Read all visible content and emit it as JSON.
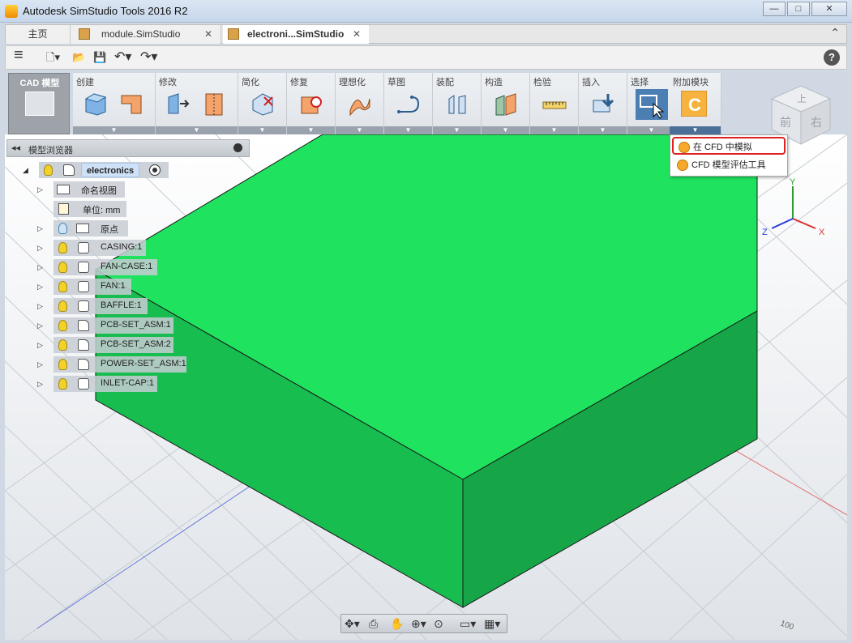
{
  "window": {
    "title": "Autodesk SimStudio Tools 2016 R2",
    "min": "—",
    "max": "□",
    "close": "✕"
  },
  "tabs": {
    "home": "主页",
    "module": "module.SimStudio",
    "active": "electroni...SimStudio",
    "close_glyph": "✕",
    "collapse": "⌃"
  },
  "quickbar": {
    "menu": "≡",
    "new": "🗋▾",
    "open": "📂",
    "save": "💾",
    "undo": "↶▾",
    "redo": "↷▾",
    "help": "?"
  },
  "ribbon": {
    "cad_tab": "CAD 模型",
    "groups": [
      {
        "label": "创建",
        "icons": [
          "box-icon",
          "sketch-l-icon"
        ]
      },
      {
        "label": "修改",
        "icons": [
          "extend-icon",
          "split-icon"
        ]
      },
      {
        "label": "简化",
        "icons": [
          "simplify-icon"
        ]
      },
      {
        "label": "修复",
        "icons": [
          "repair-icon"
        ]
      },
      {
        "label": "理想化",
        "icons": [
          "idealize-icon"
        ]
      },
      {
        "label": "草图",
        "icons": [
          "sketch-curve-icon"
        ]
      },
      {
        "label": "装配",
        "icons": [
          "assemble-icon"
        ]
      },
      {
        "label": "构造",
        "icons": [
          "construct-icon"
        ]
      },
      {
        "label": "检验",
        "icons": [
          "measure-icon"
        ]
      },
      {
        "label": "插入",
        "icons": [
          "insert-icon"
        ]
      },
      {
        "label": "选择",
        "icons": [
          "select-icon"
        ]
      },
      {
        "label": "附加模块",
        "icons": [
          "cfd-addin-icon"
        ]
      }
    ],
    "foot_arrow": "▼"
  },
  "dropdown": {
    "items": [
      "在 CFD 中模拟",
      "CFD 模型评估工具"
    ]
  },
  "browser": {
    "title": "模型浏览器",
    "collapse_glyph": "◂◂",
    "root": "electronics",
    "named_views": "命名视图",
    "units": "单位: mm",
    "origin": "原点",
    "components": [
      "CASING:1",
      "FAN-CASE:1",
      "FAN:1",
      "BAFFLE:1",
      "PCB-SET_ASM:1",
      "PCB-SET_ASM:2",
      "POWER-SET_ASM:1",
      "INLET-CAP:1"
    ]
  },
  "viewcube": {
    "top": "上",
    "front": "前",
    "right": "右"
  },
  "axes": {
    "x": "X",
    "y": "Y",
    "z": "Z"
  },
  "grid_label": "100",
  "colors": {
    "box_top": "#1fe35f",
    "box_front": "#18bd4f",
    "box_side": "#16a647",
    "accent": "#4b6f96",
    "highlight": "#e02020"
  }
}
